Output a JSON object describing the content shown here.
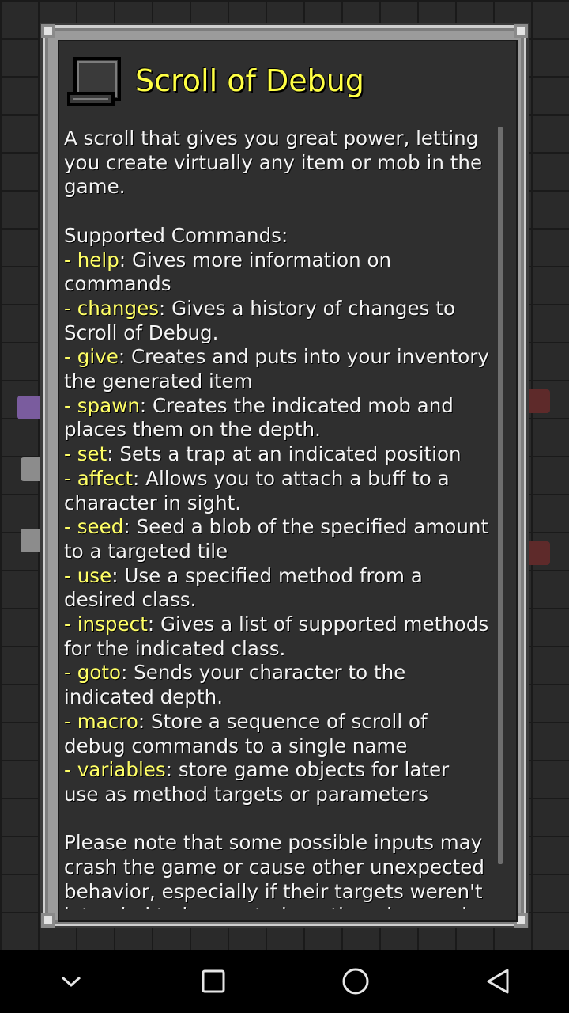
{
  "dialog": {
    "title": "Scroll of Debug",
    "intro": [
      "A scroll that gives you great power, letting",
      "you create virtually any item or mob in the",
      "game."
    ],
    "commands_header": "Supported Commands:",
    "commands": [
      {
        "prefix": "- ",
        "name": "help",
        "text": [
          ": Gives more information on",
          "commands"
        ]
      },
      {
        "prefix": "- ",
        "name": "changes",
        "text": [
          ": Gives a history of changes to",
          "Scroll of Debug."
        ]
      },
      {
        "prefix": "- ",
        "name": "give",
        "text": [
          ": Creates and puts into your inventory",
          "the generated item"
        ]
      },
      {
        "prefix": "- ",
        "name": "spawn",
        "text": [
          ": Creates the indicated mob and",
          "places them on the depth."
        ]
      },
      {
        "prefix": "- ",
        "name": "set",
        "text": [
          ": Sets a trap at an indicated position"
        ]
      },
      {
        "prefix": "- ",
        "name": "affect",
        "text": [
          ": Allows you to attach a buff to a",
          "character in sight."
        ]
      },
      {
        "prefix": "- ",
        "name": "seed",
        "text": [
          ": Seed a blob of the specified amount",
          "to a targeted tile"
        ]
      },
      {
        "prefix": "- ",
        "name": "use",
        "text": [
          ": Use a specified method from a",
          "desired class."
        ]
      },
      {
        "prefix": "- ",
        "name": "inspect",
        "text": [
          ": Gives a list of supported methods",
          "for the indicated class."
        ]
      },
      {
        "prefix": "- ",
        "name": "goto",
        "text": [
          ": Sends your character to the",
          "indicated depth."
        ]
      },
      {
        "prefix": "- ",
        "name": "macro",
        "text": [
          ": Store a sequence of scroll of",
          "debug commands to a single name"
        ]
      },
      {
        "prefix": "- ",
        "name": "variables",
        "text": [
          ": store game objects for later",
          "use as method targets or parameters"
        ]
      }
    ],
    "note": [
      "Please note that some possible inputs may",
      "crash the game or cause other unexpected",
      "behavior, especially if their targets weren't",
      "intended to be created or otherwise used"
    ]
  },
  "icons": {
    "dialog_icon": "scroll-icon",
    "nav": [
      "chevron-down-icon",
      "recent-apps-icon",
      "home-icon",
      "back-icon"
    ]
  },
  "colors": {
    "title": "#ffff44",
    "command": "#ffff66",
    "text": "#f4f4f4",
    "panel": "#2f2f2f"
  }
}
